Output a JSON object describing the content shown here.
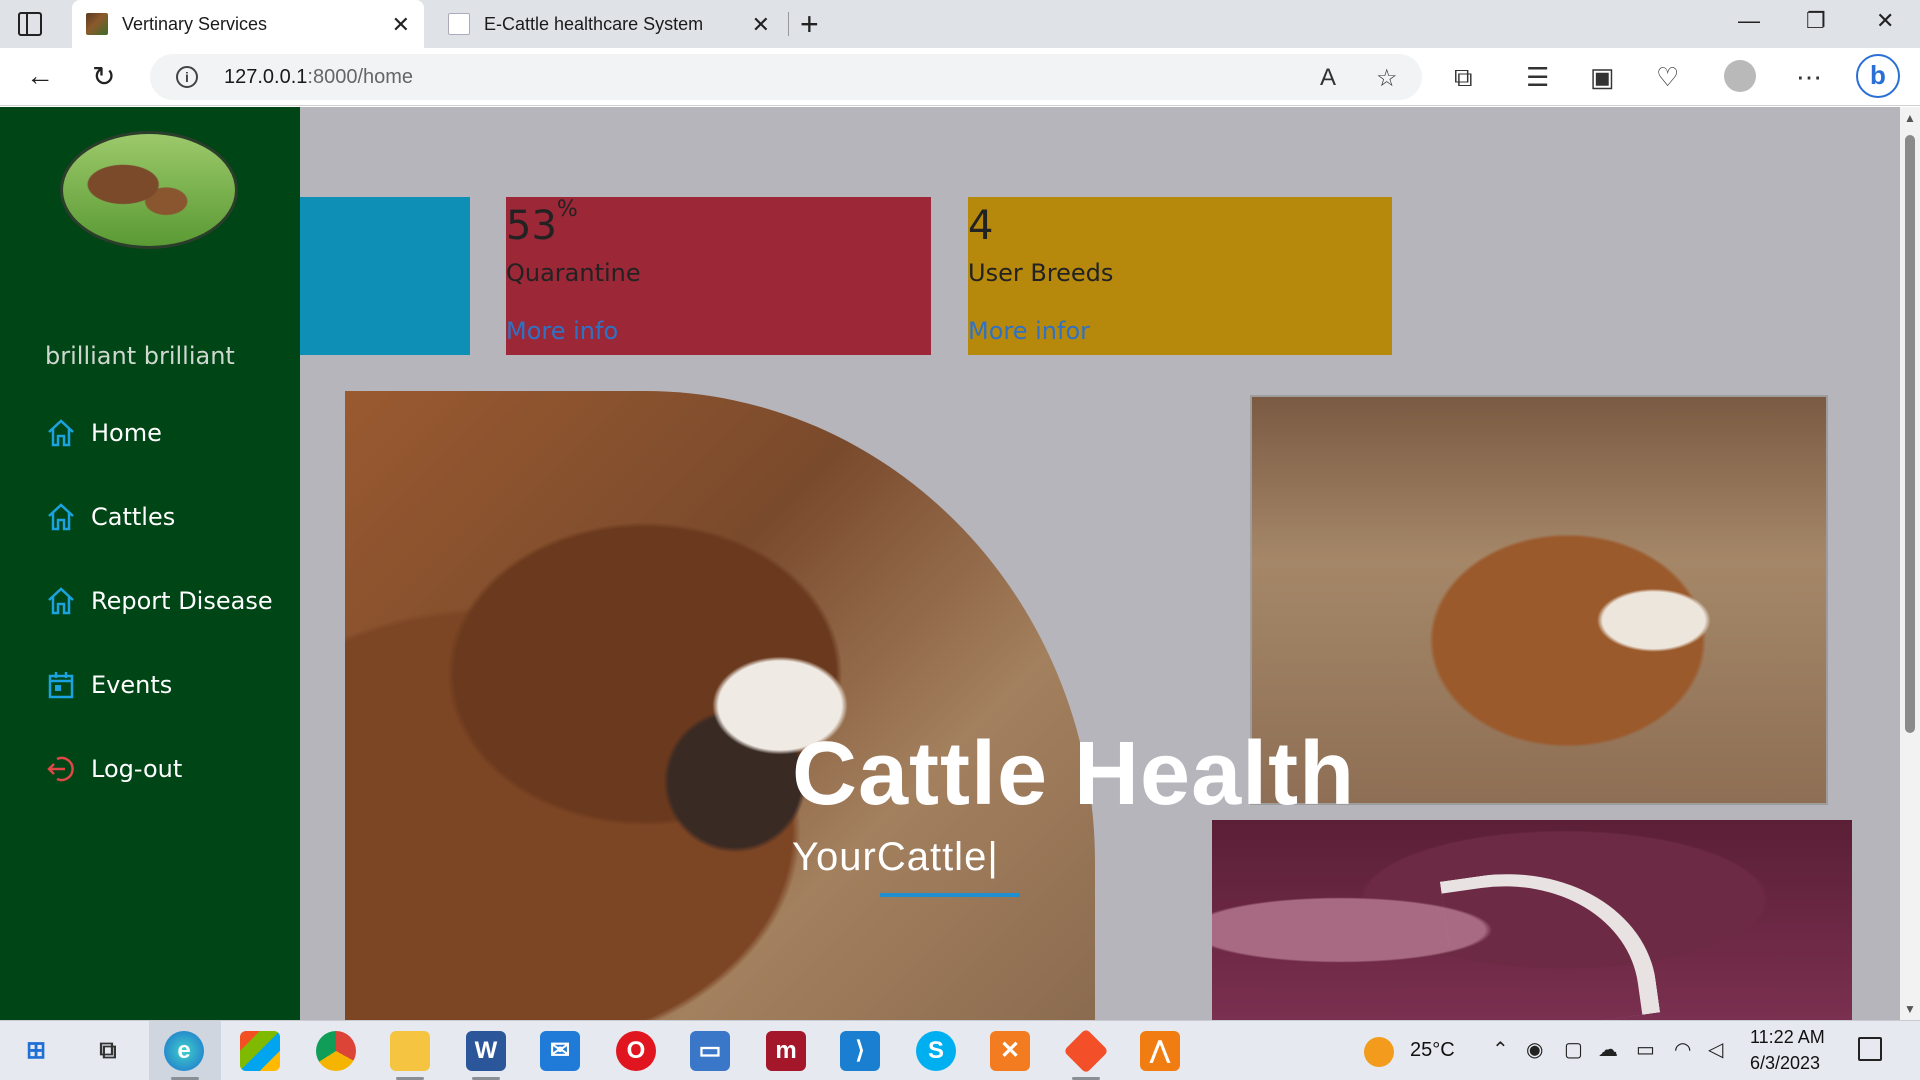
{
  "browser": {
    "tabs": [
      {
        "title": "Vertinary Services",
        "active": true
      },
      {
        "title": "E-Cattle healthcare System",
        "active": false
      }
    ],
    "url_host": "127.0.0.1",
    "url_rest": ":8000/home",
    "new_tab_icon": "plus-icon",
    "icons": [
      "sidebar-toggle-icon",
      "back-arrow-icon",
      "refresh-icon",
      "site-info-icon",
      "read-aloud-icon",
      "favorite-add-icon",
      "extensions-icon",
      "favorites-icon",
      "collections-icon",
      "browser-essentials-icon",
      "profile-icon",
      "more-icon",
      "bing-icon"
    ]
  },
  "sidebar": {
    "username": "brilliant brilliant",
    "items": [
      {
        "label": "Home",
        "icon": "home-icon"
      },
      {
        "label": "Cattles",
        "icon": "home-icon"
      },
      {
        "label": "Report Disease",
        "icon": "home-icon"
      },
      {
        "label": "Events",
        "icon": "calendar-icon"
      },
      {
        "label": "Log-out",
        "icon": "logout-icon"
      }
    ]
  },
  "cards": [
    {
      "value": "",
      "label": "",
      "link": "",
      "color": "#0e8fb5"
    },
    {
      "value": "53",
      "suffix": "%",
      "label": "Quarantine",
      "link": "More info",
      "color": "#9b2737"
    },
    {
      "value": "4",
      "label": "User Breeds",
      "link": "More infor",
      "color": "#b6890c"
    }
  ],
  "hero": {
    "title": "Cattle Health",
    "subtitle": "YourCattle|"
  },
  "taskbar": {
    "apps": [
      "windows-start-icon",
      "task-view-icon",
      "edge-icon",
      "store-icon",
      "chrome-icon",
      "file-explorer-icon",
      "word-icon",
      "mail-icon",
      "opera-icon",
      "remote-desktop-icon",
      "mendeley-icon",
      "vscode-icon",
      "skype-icon",
      "xampp-icon",
      "git-icon",
      "app-icon"
    ],
    "weather_temp": "25°C",
    "time": "11:22 AM",
    "date": "6/3/2023"
  },
  "colors": {
    "sidebar_bg": "#004516",
    "page_bg": "#b5b5bb",
    "link": "#2f72c5",
    "accent_line": "#1f8fd0"
  }
}
